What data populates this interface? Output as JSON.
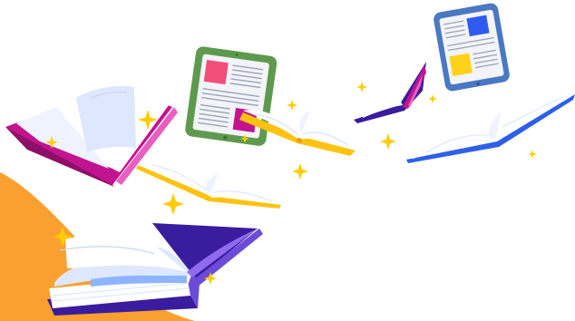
{
  "scene": {
    "description_icons": [
      "orange-swoosh",
      "open-book-magenta",
      "open-book-purple",
      "open-book-yellow-small",
      "open-book-yellow-center",
      "open-book-blue",
      "tablet-green",
      "tablet-blue",
      "sparkle"
    ]
  },
  "colors": {
    "orange": "#F9A030",
    "magenta": "#C2148F",
    "magenta_dark": "#8E0F69",
    "pink_edge": "#E85FC0",
    "purple": "#3A1C9E",
    "purple_light": "#8E6BEF",
    "purple_edge": "#6C4BD8",
    "yellow": "#FFC20E",
    "yellow_dark": "#E89E00",
    "blue": "#2D5FE8",
    "page_white": "#FFFFFF",
    "page_light": "#EEF3FF",
    "page_blue": "#DDE8FF",
    "tablet_green": "#5E9A4E",
    "tablet_blue": "#4A78C2",
    "screen_bg": "#F2F4FA",
    "tile_pink": "#F24E7A",
    "tile_magenta": "#C2148F",
    "tile_blue": "#2F5BF0",
    "tile_yellow": "#FFD21A",
    "line_gray": "#9BA3B5",
    "sparkle": "#FFCC00"
  }
}
